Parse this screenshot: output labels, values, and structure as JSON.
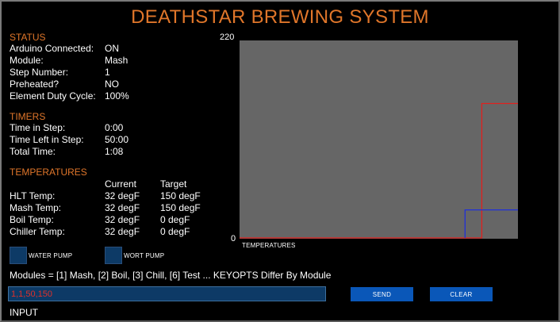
{
  "title": "DEATHSTAR BREWING SYSTEM",
  "status": {
    "heading": "STATUS",
    "rows": [
      {
        "label": "Arduino Connected:",
        "value": "ON"
      },
      {
        "label": "Module:",
        "value": "Mash"
      },
      {
        "label": "Step Number:",
        "value": "1"
      },
      {
        "label": "Preheated?",
        "value": "NO"
      },
      {
        "label": "Element Duty Cycle:",
        "value": "100%"
      }
    ]
  },
  "timers": {
    "heading": "TIMERS",
    "rows": [
      {
        "label": "Time in Step:",
        "value": "0:00"
      },
      {
        "label": "Time Left in Step:",
        "value": "50:00"
      },
      {
        "label": "Total Time:",
        "value": "1:08"
      }
    ]
  },
  "temperatures": {
    "heading": "TEMPERATURES",
    "col_current": "Current",
    "col_target": "Target",
    "rows": [
      {
        "label": "HLT Temp:",
        "current": "32 degF",
        "target": "150 degF"
      },
      {
        "label": "Mash Temp:",
        "current": "32 degF",
        "target": "150 degF"
      },
      {
        "label": "Boil Temp:",
        "current": "32 degF",
        "target": "0 degF"
      },
      {
        "label": "Chiller Temp:",
        "current": "32 degF",
        "target": "0 degF"
      }
    ]
  },
  "chart_data": {
    "type": "line",
    "xlabel": "TEMPERATURES",
    "ylabel": "",
    "ylim": [
      0,
      220
    ],
    "y_ticks": [
      "220",
      "0"
    ],
    "xlim": [
      0,
      100
    ],
    "grid": false,
    "background": "#666666",
    "series": [
      {
        "color": "#e0201e",
        "x": [
          0,
          87,
          87,
          100
        ],
        "y": [
          0,
          0,
          150,
          150
        ]
      },
      {
        "color": "#2030d8",
        "x": [
          81,
          81,
          100
        ],
        "y": [
          0,
          32,
          32
        ]
      }
    ]
  },
  "pumps": [
    {
      "label": "WATER PUMP",
      "color": "#0d3a66"
    },
    {
      "label": "WORT PUMP",
      "color": "#0d3a66"
    }
  ],
  "modules_help": "Modules = [1] Mash, [2] Boil, [3] Chill, [6] Test ... KEYOPTS Differ By Module",
  "command": {
    "value": "1,1,50,150",
    "send_label": "SEND",
    "clear_label": "CLEAR",
    "input_label": "INPUT"
  },
  "colors": {
    "accent": "#e0762a",
    "button": "#0a57b8",
    "input_bg": "#0d3a66"
  }
}
